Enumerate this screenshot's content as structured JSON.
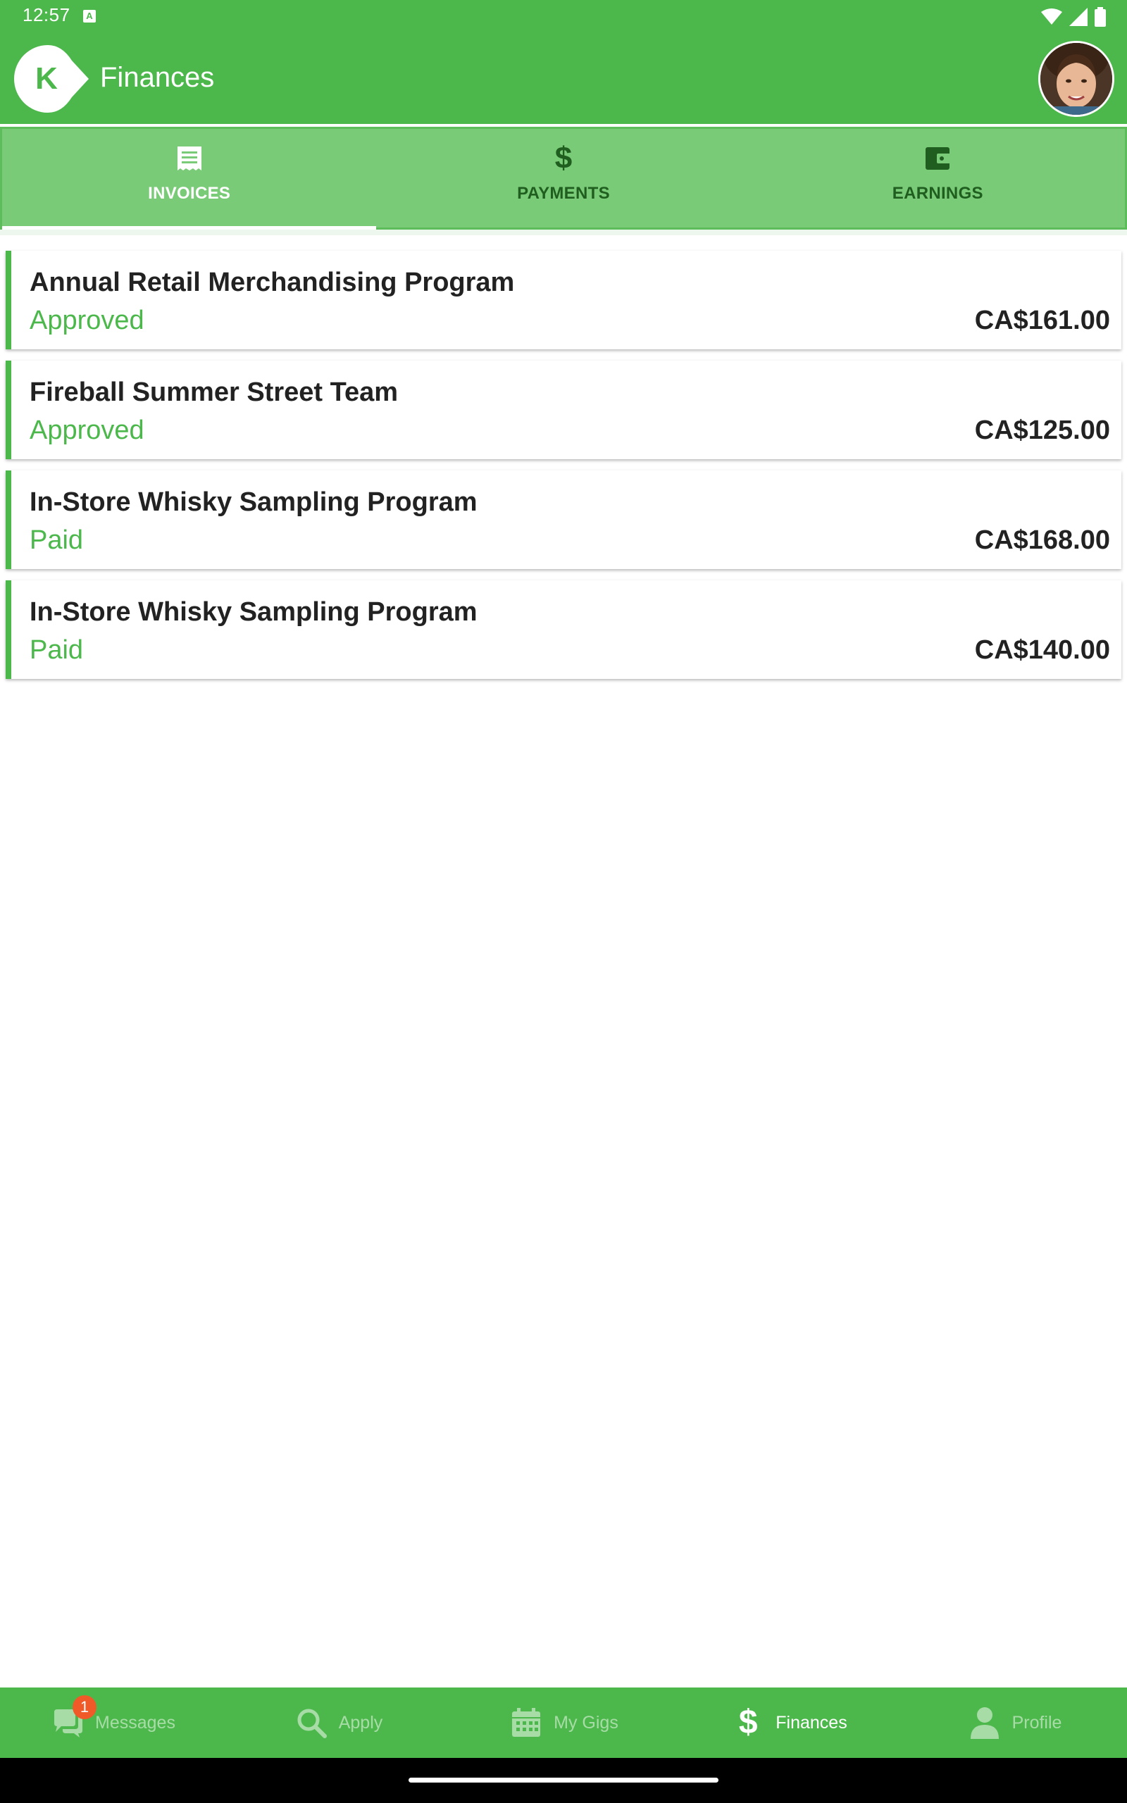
{
  "status_bar": {
    "time": "12:57",
    "indicator": "A",
    "icons": [
      "wifi-icon",
      "signal-icon",
      "battery-icon"
    ]
  },
  "app_bar": {
    "title": "Finances",
    "logo_letter": "K",
    "avatar": "user-avatar"
  },
  "tabs": [
    {
      "label": "INVOICES",
      "icon": "receipt-icon",
      "active": true
    },
    {
      "label": "PAYMENTS",
      "icon": "dollar-icon",
      "active": false
    },
    {
      "label": "EARNINGS",
      "icon": "wallet-icon",
      "active": false
    }
  ],
  "invoices": [
    {
      "title": "Annual Retail Merchandising Program",
      "status": "Approved",
      "amount": "CA$161.00"
    },
    {
      "title": "Fireball Summer Street Team",
      "status": "Approved",
      "amount": "CA$125.00"
    },
    {
      "title": "In-Store Whisky Sampling Program",
      "status": "Paid",
      "amount": "CA$168.00"
    },
    {
      "title": "In-Store Whisky Sampling Program",
      "status": "Paid",
      "amount": "CA$140.00"
    }
  ],
  "bottom_nav": [
    {
      "label": "Messages",
      "icon": "chat-icon",
      "badge": "1",
      "active": false
    },
    {
      "label": "Apply",
      "icon": "search-icon",
      "active": false
    },
    {
      "label": "My Gigs",
      "icon": "calendar-icon",
      "active": false
    },
    {
      "label": "Finances",
      "icon": "dollar-icon",
      "active": true
    },
    {
      "label": "Profile",
      "icon": "person-icon",
      "active": false
    }
  ],
  "colors": {
    "primary": "#4cb84c",
    "tab_background": "#7acb78",
    "status_text": "#4cb84c",
    "badge": "#f05a28",
    "inactive_nav": "#a8dca7"
  }
}
